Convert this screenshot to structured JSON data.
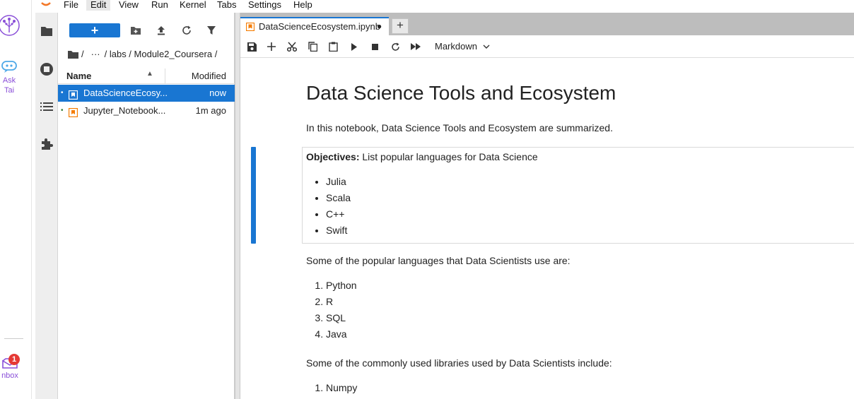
{
  "colors": {
    "accent": "#1976d2",
    "outer_accent": "#8a4fd8",
    "badge": "#e53935",
    "notebook_icon": "#f57c00"
  },
  "outer_sidebar": {
    "ask_label_line1": "Ask",
    "ask_label_line2": "Tai",
    "inbox_label": "nbox",
    "inbox_badge": "1"
  },
  "menu": [
    "File",
    "Edit",
    "View",
    "Run",
    "Kernel",
    "Tabs",
    "Settings",
    "Help"
  ],
  "menu_active": "Edit",
  "filebrowser": {
    "new_button": "+",
    "breadcrumb": {
      "root": "/",
      "ellipsis": "···",
      "path": "/ labs / Module2_Coursera /"
    },
    "header_name": "Name",
    "header_sort": "▲",
    "header_modified": "Modified",
    "files": [
      {
        "name": "DataScienceEcosy...",
        "modified": "now",
        "selected": true,
        "dot": "•"
      },
      {
        "name": "Jupyter_Notebook...",
        "modified": "1m ago",
        "selected": false,
        "dot": "•"
      }
    ]
  },
  "tab": {
    "label": "DataScienceEcosystem.ipynb",
    "dirty_dot": "●",
    "add_label": "+"
  },
  "toolbar": {
    "cell_type": "Markdown"
  },
  "notebook": {
    "title": "Data Science Tools and Ecosystem",
    "intro": "In this notebook, Data Science Tools and Ecosystem are summarized.",
    "objectives_label": "Objectives:",
    "objectives_text": " List popular languages for Data Science",
    "objective_items": [
      "Julia",
      "Scala",
      "C++",
      "Swift"
    ],
    "languages_intro": "Some of the popular languages that Data Scientists use are:",
    "languages": [
      "Python",
      "R",
      "SQL",
      "Java"
    ],
    "libraries_intro": "Some of the commonly used libraries used by Data Scientists include:",
    "libraries": [
      "Numpy"
    ]
  }
}
